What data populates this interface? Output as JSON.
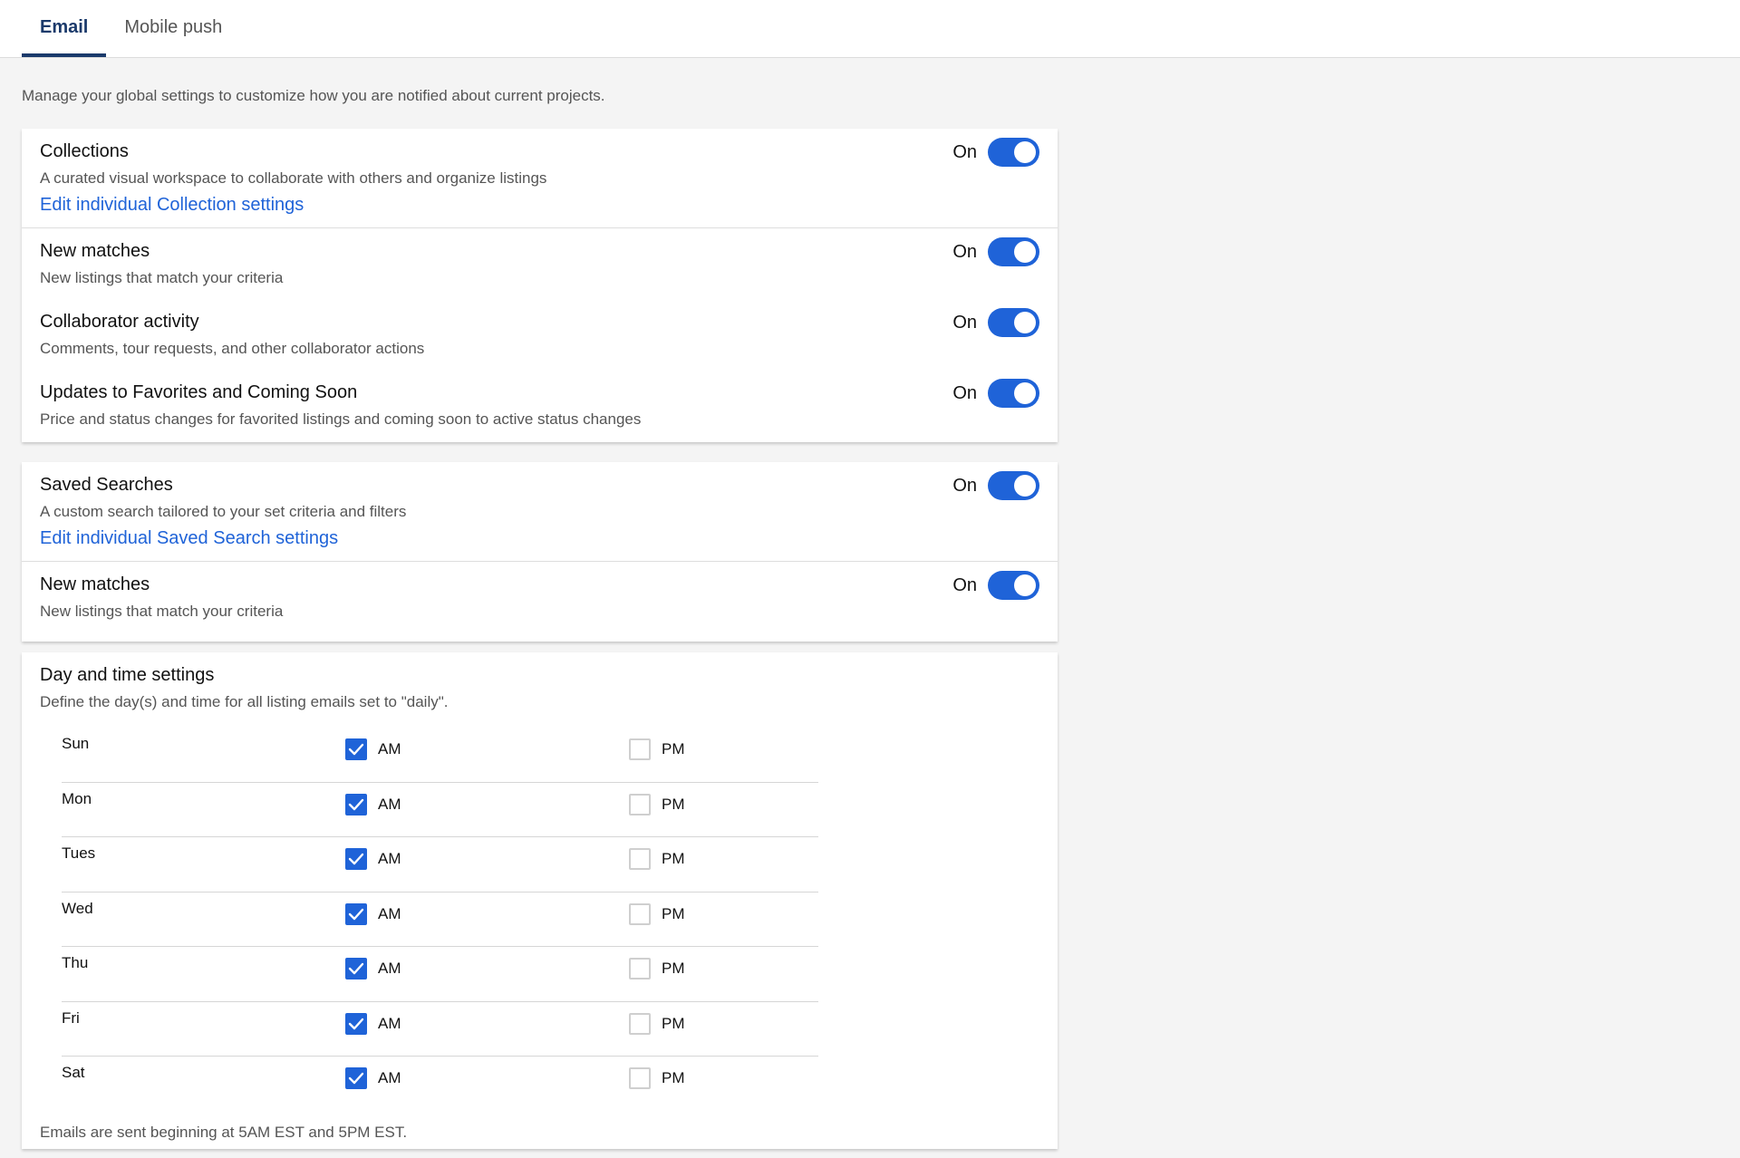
{
  "tabs": [
    {
      "label": "Email",
      "active": true
    },
    {
      "label": "Mobile push",
      "active": false
    }
  ],
  "intro": "Manage your global settings to customize how you are notified about current projects.",
  "collections_card": {
    "header": {
      "title": "Collections",
      "desc": "A curated visual workspace to collaborate with others and organize listings",
      "link": "Edit individual Collection settings",
      "toggle": "On"
    },
    "items": [
      {
        "title": "New matches",
        "desc": "New listings that match your criteria",
        "toggle": "On"
      },
      {
        "title": "Collaborator activity",
        "desc": "Comments, tour requests, and other collaborator actions",
        "toggle": "On"
      },
      {
        "title": "Updates to Favorites and Coming Soon",
        "desc": "Price and status changes for favorited listings and coming soon to active status changes",
        "toggle": "On"
      }
    ]
  },
  "saved_card": {
    "header": {
      "title": "Saved Searches",
      "desc": "A custom search tailored to your set criteria and filters",
      "link": "Edit individual Saved Search settings",
      "toggle": "On"
    },
    "items": [
      {
        "title": "New matches",
        "desc": "New listings that match your criteria",
        "toggle": "On"
      }
    ]
  },
  "day_time": {
    "title": "Day and time settings",
    "desc": "Define the day(s) and time for all listing emails set to \"daily\".",
    "am_label": "AM",
    "pm_label": "PM",
    "days": [
      {
        "name": "Sun",
        "am": true,
        "pm": false
      },
      {
        "name": "Mon",
        "am": true,
        "pm": false
      },
      {
        "name": "Tues",
        "am": true,
        "pm": false
      },
      {
        "name": "Wed",
        "am": true,
        "pm": false
      },
      {
        "name": "Thu",
        "am": true,
        "pm": false
      },
      {
        "name": "Fri",
        "am": true,
        "pm": false
      },
      {
        "name": "Sat",
        "am": true,
        "pm": false
      }
    ],
    "footer": "Emails are sent beginning at 5AM EST and 5PM EST."
  },
  "colors": {
    "accent": "#1f63d8",
    "tab_active": "#1b3a6b"
  }
}
